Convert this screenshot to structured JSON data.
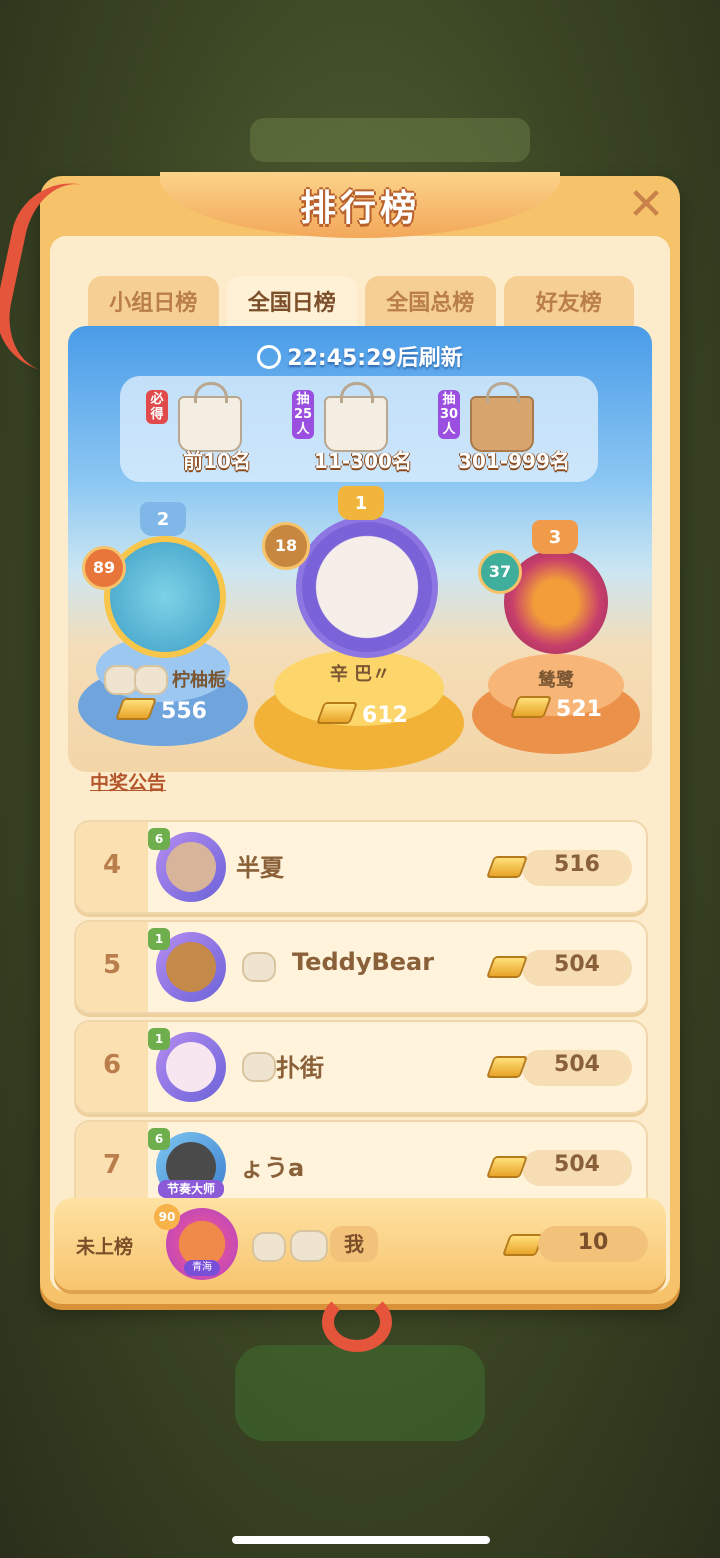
{
  "panel": {
    "title": "排行榜",
    "close_label": "✕"
  },
  "tabs": [
    {
      "label": "小组日榜",
      "active": false
    },
    {
      "label": "全国日榜",
      "active": true
    },
    {
      "label": "全国总榜",
      "active": false
    },
    {
      "label": "好友榜",
      "active": false
    }
  ],
  "refresh_text": "22:45:29后刷新",
  "rewards": [
    {
      "tag": "必得",
      "label": "前10名",
      "tag_color": "#e04a4a"
    },
    {
      "tag": "抽25人",
      "label": "11-300名",
      "tag_color": "#9b4fe0"
    },
    {
      "tag": "抽30人",
      "label": "301-999名",
      "tag_color": "#9b4fe0"
    }
  ],
  "podium": {
    "first": {
      "rank": "1",
      "level": "18",
      "name": "辛 巴〃",
      "score": "612"
    },
    "second": {
      "rank": "2",
      "level": "89",
      "name": "柠柚栀",
      "score": "556"
    },
    "third": {
      "rank": "3",
      "level": "37",
      "name": "鸶鹭",
      "score": "521"
    }
  },
  "announcement_link": "中奖公告",
  "rows": [
    {
      "rank": "4",
      "level": "6",
      "name": "半夏",
      "score": "516"
    },
    {
      "rank": "5",
      "level": "1",
      "name": "TeddyBear",
      "score": "504"
    },
    {
      "rank": "6",
      "level": "1",
      "name": "扑街",
      "score": "504"
    },
    {
      "rank": "7",
      "level": "6",
      "name": "ょうa",
      "score": "504",
      "title_badge": "节奏大师"
    }
  ],
  "my_row": {
    "rank_text": "未上榜",
    "level": "90",
    "region_badge": "青海",
    "name": "我",
    "score": "10"
  },
  "colors": {
    "panel": "#f6c36a",
    "panel_inner": "#fdeccb",
    "title_shadow": "#b8612c",
    "ribbon": "#e4553b",
    "first_ring": "#7a62d8",
    "second_pod": "#7fb3e6",
    "first_pod": "#f7c24a",
    "third_pod": "#f3a05c"
  }
}
